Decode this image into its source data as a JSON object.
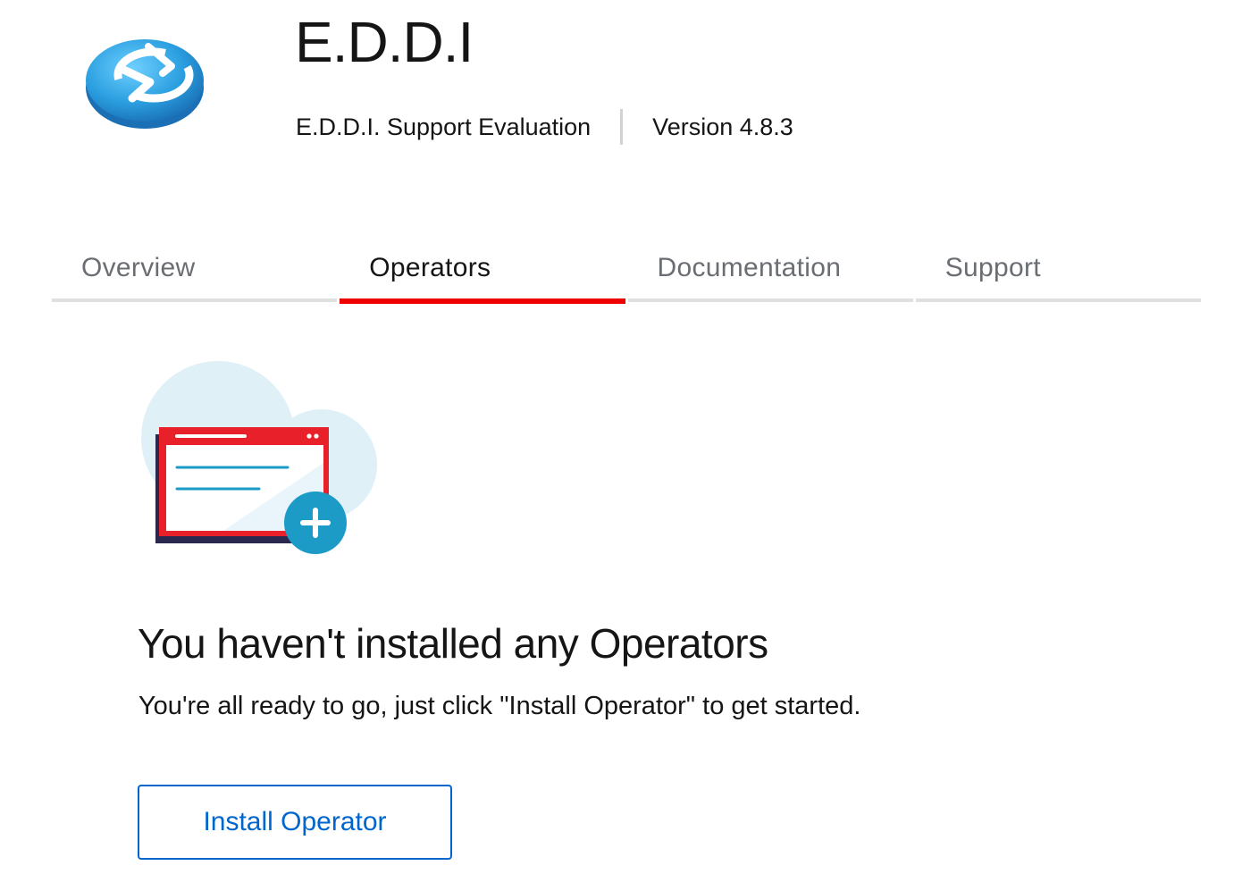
{
  "header": {
    "title": "E.D.D.I",
    "subtitle": "E.D.D.I. Support Evaluation",
    "version": "Version 4.8.3",
    "logo_icon": "eddi-logo-icon"
  },
  "tabs": [
    {
      "label": "Overview",
      "active": false
    },
    {
      "label": "Operators",
      "active": true
    },
    {
      "label": "Documentation",
      "active": false
    },
    {
      "label": "Support",
      "active": false
    }
  ],
  "empty_state": {
    "icon": "add-application-illustration",
    "title": "You haven't installed any Operators",
    "body": "You're all ready to go, just click \"Install Operator\" to get started.",
    "button_label": "Install Operator"
  },
  "colors": {
    "active_tab": "#ee0000",
    "primary_link": "#0066cc",
    "illustration_red": "#e8202a",
    "illustration_cloud": "#dff0f7",
    "illustration_teal": "#1b9bc6",
    "logo_blue": "#2b9fe0"
  }
}
